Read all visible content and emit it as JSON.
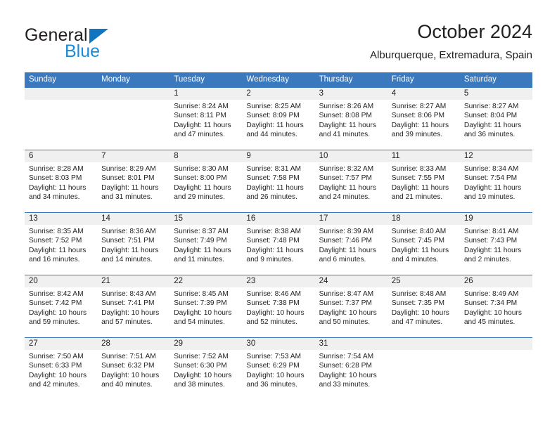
{
  "brand": {
    "name_part1": "General",
    "name_part2": "Blue",
    "triangle_icon": "triangle-icon",
    "color_dark": "#231f20",
    "color_blue": "#1c8ad6"
  },
  "header": {
    "title": "October 2024",
    "subtitle": "Alburquerque, Extremadura, Spain"
  },
  "theme": {
    "header_blue": "#3b79bf",
    "day_number_band": "#f0f0f0",
    "text": "#221f1f"
  },
  "calendar": {
    "weekdays": [
      "Sunday",
      "Monday",
      "Tuesday",
      "Wednesday",
      "Thursday",
      "Friday",
      "Saturday"
    ],
    "weeks": [
      [
        {
          "day": "",
          "sunrise": "",
          "sunset": "",
          "daylight_line1": "",
          "daylight_line2": ""
        },
        {
          "day": "",
          "sunrise": "",
          "sunset": "",
          "daylight_line1": "",
          "daylight_line2": ""
        },
        {
          "day": "1",
          "sunrise": "Sunrise: 8:24 AM",
          "sunset": "Sunset: 8:11 PM",
          "daylight_line1": "Daylight: 11 hours",
          "daylight_line2": "and 47 minutes."
        },
        {
          "day": "2",
          "sunrise": "Sunrise: 8:25 AM",
          "sunset": "Sunset: 8:09 PM",
          "daylight_line1": "Daylight: 11 hours",
          "daylight_line2": "and 44 minutes."
        },
        {
          "day": "3",
          "sunrise": "Sunrise: 8:26 AM",
          "sunset": "Sunset: 8:08 PM",
          "daylight_line1": "Daylight: 11 hours",
          "daylight_line2": "and 41 minutes."
        },
        {
          "day": "4",
          "sunrise": "Sunrise: 8:27 AM",
          "sunset": "Sunset: 8:06 PM",
          "daylight_line1": "Daylight: 11 hours",
          "daylight_line2": "and 39 minutes."
        },
        {
          "day": "5",
          "sunrise": "Sunrise: 8:27 AM",
          "sunset": "Sunset: 8:04 PM",
          "daylight_line1": "Daylight: 11 hours",
          "daylight_line2": "and 36 minutes."
        }
      ],
      [
        {
          "day": "6",
          "sunrise": "Sunrise: 8:28 AM",
          "sunset": "Sunset: 8:03 PM",
          "daylight_line1": "Daylight: 11 hours",
          "daylight_line2": "and 34 minutes."
        },
        {
          "day": "7",
          "sunrise": "Sunrise: 8:29 AM",
          "sunset": "Sunset: 8:01 PM",
          "daylight_line1": "Daylight: 11 hours",
          "daylight_line2": "and 31 minutes."
        },
        {
          "day": "8",
          "sunrise": "Sunrise: 8:30 AM",
          "sunset": "Sunset: 8:00 PM",
          "daylight_line1": "Daylight: 11 hours",
          "daylight_line2": "and 29 minutes."
        },
        {
          "day": "9",
          "sunrise": "Sunrise: 8:31 AM",
          "sunset": "Sunset: 7:58 PM",
          "daylight_line1": "Daylight: 11 hours",
          "daylight_line2": "and 26 minutes."
        },
        {
          "day": "10",
          "sunrise": "Sunrise: 8:32 AM",
          "sunset": "Sunset: 7:57 PM",
          "daylight_line1": "Daylight: 11 hours",
          "daylight_line2": "and 24 minutes."
        },
        {
          "day": "11",
          "sunrise": "Sunrise: 8:33 AM",
          "sunset": "Sunset: 7:55 PM",
          "daylight_line1": "Daylight: 11 hours",
          "daylight_line2": "and 21 minutes."
        },
        {
          "day": "12",
          "sunrise": "Sunrise: 8:34 AM",
          "sunset": "Sunset: 7:54 PM",
          "daylight_line1": "Daylight: 11 hours",
          "daylight_line2": "and 19 minutes."
        }
      ],
      [
        {
          "day": "13",
          "sunrise": "Sunrise: 8:35 AM",
          "sunset": "Sunset: 7:52 PM",
          "daylight_line1": "Daylight: 11 hours",
          "daylight_line2": "and 16 minutes."
        },
        {
          "day": "14",
          "sunrise": "Sunrise: 8:36 AM",
          "sunset": "Sunset: 7:51 PM",
          "daylight_line1": "Daylight: 11 hours",
          "daylight_line2": "and 14 minutes."
        },
        {
          "day": "15",
          "sunrise": "Sunrise: 8:37 AM",
          "sunset": "Sunset: 7:49 PM",
          "daylight_line1": "Daylight: 11 hours",
          "daylight_line2": "and 11 minutes."
        },
        {
          "day": "16",
          "sunrise": "Sunrise: 8:38 AM",
          "sunset": "Sunset: 7:48 PM",
          "daylight_line1": "Daylight: 11 hours",
          "daylight_line2": "and 9 minutes."
        },
        {
          "day": "17",
          "sunrise": "Sunrise: 8:39 AM",
          "sunset": "Sunset: 7:46 PM",
          "daylight_line1": "Daylight: 11 hours",
          "daylight_line2": "and 6 minutes."
        },
        {
          "day": "18",
          "sunrise": "Sunrise: 8:40 AM",
          "sunset": "Sunset: 7:45 PM",
          "daylight_line1": "Daylight: 11 hours",
          "daylight_line2": "and 4 minutes."
        },
        {
          "day": "19",
          "sunrise": "Sunrise: 8:41 AM",
          "sunset": "Sunset: 7:43 PM",
          "daylight_line1": "Daylight: 11 hours",
          "daylight_line2": "and 2 minutes."
        }
      ],
      [
        {
          "day": "20",
          "sunrise": "Sunrise: 8:42 AM",
          "sunset": "Sunset: 7:42 PM",
          "daylight_line1": "Daylight: 10 hours",
          "daylight_line2": "and 59 minutes."
        },
        {
          "day": "21",
          "sunrise": "Sunrise: 8:43 AM",
          "sunset": "Sunset: 7:41 PM",
          "daylight_line1": "Daylight: 10 hours",
          "daylight_line2": "and 57 minutes."
        },
        {
          "day": "22",
          "sunrise": "Sunrise: 8:45 AM",
          "sunset": "Sunset: 7:39 PM",
          "daylight_line1": "Daylight: 10 hours",
          "daylight_line2": "and 54 minutes."
        },
        {
          "day": "23",
          "sunrise": "Sunrise: 8:46 AM",
          "sunset": "Sunset: 7:38 PM",
          "daylight_line1": "Daylight: 10 hours",
          "daylight_line2": "and 52 minutes."
        },
        {
          "day": "24",
          "sunrise": "Sunrise: 8:47 AM",
          "sunset": "Sunset: 7:37 PM",
          "daylight_line1": "Daylight: 10 hours",
          "daylight_line2": "and 50 minutes."
        },
        {
          "day": "25",
          "sunrise": "Sunrise: 8:48 AM",
          "sunset": "Sunset: 7:35 PM",
          "daylight_line1": "Daylight: 10 hours",
          "daylight_line2": "and 47 minutes."
        },
        {
          "day": "26",
          "sunrise": "Sunrise: 8:49 AM",
          "sunset": "Sunset: 7:34 PM",
          "daylight_line1": "Daylight: 10 hours",
          "daylight_line2": "and 45 minutes."
        }
      ],
      [
        {
          "day": "27",
          "sunrise": "Sunrise: 7:50 AM",
          "sunset": "Sunset: 6:33 PM",
          "daylight_line1": "Daylight: 10 hours",
          "daylight_line2": "and 42 minutes."
        },
        {
          "day": "28",
          "sunrise": "Sunrise: 7:51 AM",
          "sunset": "Sunset: 6:32 PM",
          "daylight_line1": "Daylight: 10 hours",
          "daylight_line2": "and 40 minutes."
        },
        {
          "day": "29",
          "sunrise": "Sunrise: 7:52 AM",
          "sunset": "Sunset: 6:30 PM",
          "daylight_line1": "Daylight: 10 hours",
          "daylight_line2": "and 38 minutes."
        },
        {
          "day": "30",
          "sunrise": "Sunrise: 7:53 AM",
          "sunset": "Sunset: 6:29 PM",
          "daylight_line1": "Daylight: 10 hours",
          "daylight_line2": "and 36 minutes."
        },
        {
          "day": "31",
          "sunrise": "Sunrise: 7:54 AM",
          "sunset": "Sunset: 6:28 PM",
          "daylight_line1": "Daylight: 10 hours",
          "daylight_line2": "and 33 minutes."
        },
        {
          "day": "",
          "sunrise": "",
          "sunset": "",
          "daylight_line1": "",
          "daylight_line2": ""
        },
        {
          "day": "",
          "sunrise": "",
          "sunset": "",
          "daylight_line1": "",
          "daylight_line2": ""
        }
      ]
    ]
  }
}
